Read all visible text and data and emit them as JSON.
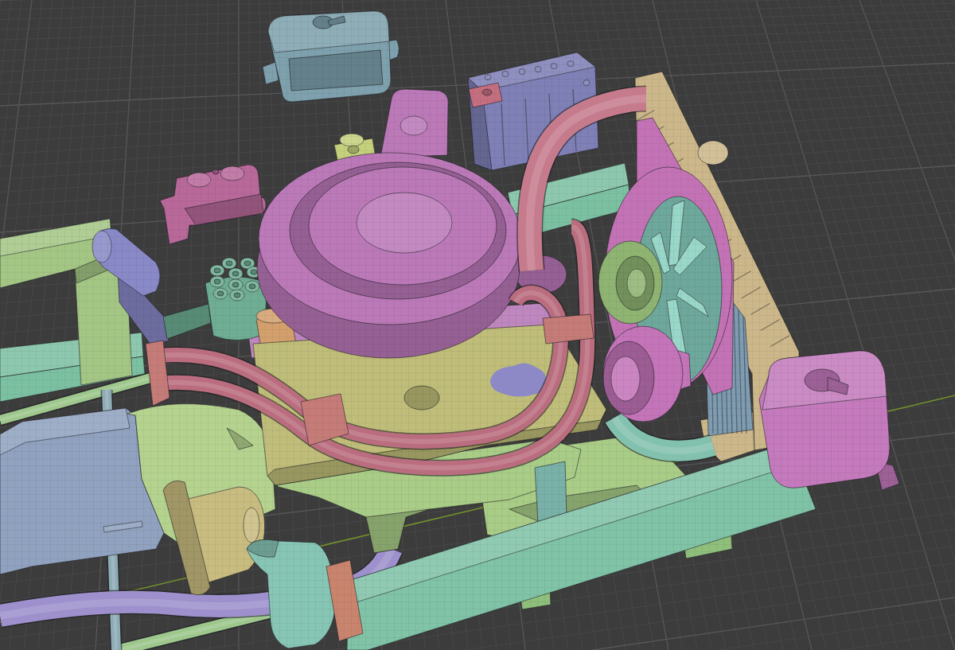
{
  "viewport": {
    "objects": [
      {
        "kind": "relaybox",
        "color": "#7ea1ad"
      },
      {
        "kind": "battery",
        "color": "#7f80b6"
      },
      {
        "kind": "terminal",
        "color": "#c46f80"
      },
      {
        "kind": "sensor",
        "color": "#c5d07c"
      },
      {
        "kind": "cylinder",
        "color": "#b8699a"
      },
      {
        "kind": "crossmember",
        "color": "#7cc0a2"
      },
      {
        "kind": "rail",
        "color": "#a4c685"
      },
      {
        "kind": "link",
        "color": "#9dc78c"
      },
      {
        "kind": "rod",
        "color": "#8eacb6"
      },
      {
        "kind": "transmission",
        "color": "#90a2bf"
      },
      {
        "kind": "exhaust",
        "color": "#9d90cc"
      },
      {
        "kind": "mounts",
        "color": "#8fbf7b"
      },
      {
        "kind": "pan",
        "color": "#a9cc87"
      },
      {
        "kind": "bellhousing",
        "color": "#b5d38f"
      },
      {
        "kind": "starter",
        "color": "#c9bc80"
      },
      {
        "kind": "column",
        "color": "#79b0a8"
      },
      {
        "kind": "frame",
        "color": "#80c3a7"
      },
      {
        "kind": "horn",
        "color": "#87c5b5"
      },
      {
        "kind": "clamp",
        "color": "#c9846e"
      },
      {
        "kind": "coil",
        "color": "#8889c6"
      },
      {
        "kind": "intake",
        "color": "#be87be"
      },
      {
        "kind": "distributor",
        "color": "#6fae94"
      },
      {
        "kind": "filler",
        "color": "#d3a06d"
      },
      {
        "kind": "block",
        "color": "#bfbd79"
      },
      {
        "kind": "plate",
        "color": "#8c89c6"
      },
      {
        "kind": "radiator",
        "color": "#ccb78a"
      },
      {
        "kind": "core",
        "color": "#7f9cb1"
      },
      {
        "kind": "shroud",
        "color": "#c373b5"
      },
      {
        "kind": "fan",
        "color": "#8ad1c2"
      },
      {
        "kind": "pulley",
        "color": "#8fb472"
      },
      {
        "kind": "tube",
        "color": "#83c1af"
      },
      {
        "kind": "alternator",
        "color": "#c475b9"
      },
      {
        "kind": "filter",
        "color": "#bb79b8"
      },
      {
        "kind": "hose",
        "color": "#c57b8c"
      },
      {
        "kind": "wires",
        "color": "#ba6d7e"
      },
      {
        "kind": "clips",
        "color": "#c57c78"
      },
      {
        "kind": "tank",
        "color": "#c47abc"
      }
    ]
  }
}
